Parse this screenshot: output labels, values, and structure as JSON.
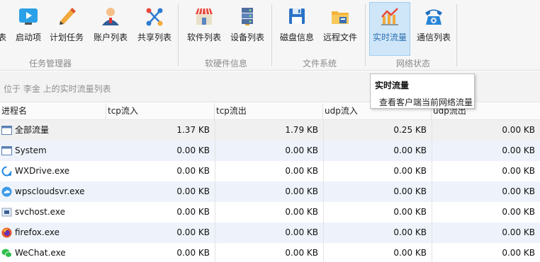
{
  "ribbon": {
    "buttons": [
      {
        "id": "partial",
        "label": "表"
      },
      {
        "id": "startup",
        "label": "启动项"
      },
      {
        "id": "tasks",
        "label": "计划任务"
      },
      {
        "id": "accounts",
        "label": "账户列表"
      },
      {
        "id": "shares",
        "label": "共享列表"
      },
      {
        "id": "software",
        "label": "软件列表"
      },
      {
        "id": "devices",
        "label": "设备列表"
      },
      {
        "id": "disk",
        "label": "磁盘信息"
      },
      {
        "id": "remotefiles",
        "label": "远程文件"
      },
      {
        "id": "traffic",
        "label": "实时流量"
      },
      {
        "id": "comms",
        "label": "通信列表"
      }
    ],
    "groups": [
      "任务管理器",
      "软硬件信息",
      "文件系统",
      "网络状态"
    ]
  },
  "pathbar": {
    "text": "位于 李金 上的实时流量列表"
  },
  "tooltip": {
    "title": "实时流量",
    "description": "查看客户端当前网络流量"
  },
  "table": {
    "columns": [
      "进程名",
      "tcp流入",
      "tcp流出",
      "udp流入",
      "udp流出"
    ],
    "rows": [
      {
        "name": "全部流量",
        "tcp_in": "1.37 KB",
        "tcp_out": "1.79 KB",
        "udp_in": "0.25 KB",
        "udp_out": "0.00 KB",
        "icon": "window-icon"
      },
      {
        "name": "System",
        "tcp_in": "0.00 KB",
        "tcp_out": "0.00 KB",
        "udp_in": "0.00 KB",
        "udp_out": "0.00 KB",
        "icon": "window-icon"
      },
      {
        "name": "WXDrive.exe",
        "tcp_in": "0.00 KB",
        "tcp_out": "0.00 KB",
        "udp_in": "0.00 KB",
        "udp_out": "0.00 KB",
        "icon": "wxdrive-icon"
      },
      {
        "name": "wpscloudsvr.exe",
        "tcp_in": "0.00 KB",
        "tcp_out": "0.00 KB",
        "udp_in": "0.00 KB",
        "udp_out": "0.00 KB",
        "icon": "cloud-icon"
      },
      {
        "name": "svchost.exe",
        "tcp_in": "0.00 KB",
        "tcp_out": "0.00 KB",
        "udp_in": "0.00 KB",
        "udp_out": "0.00 KB",
        "icon": "svchost-icon"
      },
      {
        "name": "firefox.exe",
        "tcp_in": "0.00 KB",
        "tcp_out": "0.00 KB",
        "udp_in": "0.00 KB",
        "udp_out": "0.00 KB",
        "icon": "firefox-icon"
      },
      {
        "name": "WeChat.exe",
        "tcp_in": "0.00 KB",
        "tcp_out": "0.00 KB",
        "udp_in": "0.00 KB",
        "udp_out": "0.00 KB",
        "icon": "wechat-icon"
      }
    ]
  },
  "colors": {
    "accent": "#2a6fb0",
    "active_bg": "#cfe6f8",
    "row_alt": "#eef3fb"
  }
}
